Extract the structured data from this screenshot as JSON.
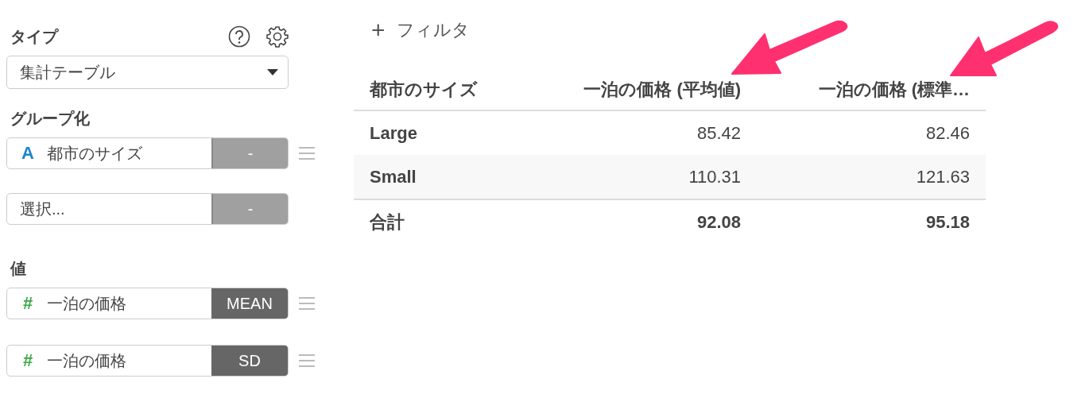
{
  "sidebar": {
    "type_label": "タイプ",
    "type_select": {
      "value": "集計テーブル"
    },
    "group_label": "グループ化",
    "group_fields": [
      {
        "kind": "text",
        "icon": "A",
        "value": "都市のサイズ",
        "button": "-",
        "draggable": true
      },
      {
        "kind": "empty",
        "placeholder": "選択...",
        "button": "-",
        "draggable": false
      }
    ],
    "value_label": "値",
    "value_fields": [
      {
        "kind": "number",
        "icon": "#",
        "value": "一泊の価格",
        "button": "MEAN",
        "draggable": true
      },
      {
        "kind": "number",
        "icon": "#",
        "value": "一泊の価格",
        "button": "SD",
        "draggable": true
      }
    ]
  },
  "filter": {
    "icon": "+",
    "label": "フィルタ"
  },
  "table": {
    "columns": [
      {
        "label": "都市のサイズ"
      },
      {
        "label": "一泊の価格 (平均値)"
      },
      {
        "label": "一泊の価格 (標準…"
      }
    ],
    "rows": [
      {
        "kind": "data",
        "cells": [
          "Large",
          "85.42",
          "82.46"
        ]
      },
      {
        "kind": "data",
        "cells": [
          "Small",
          "110.31",
          "121.63"
        ]
      },
      {
        "kind": "total",
        "cells": [
          "合計",
          "92.08",
          "95.18"
        ]
      }
    ]
  }
}
